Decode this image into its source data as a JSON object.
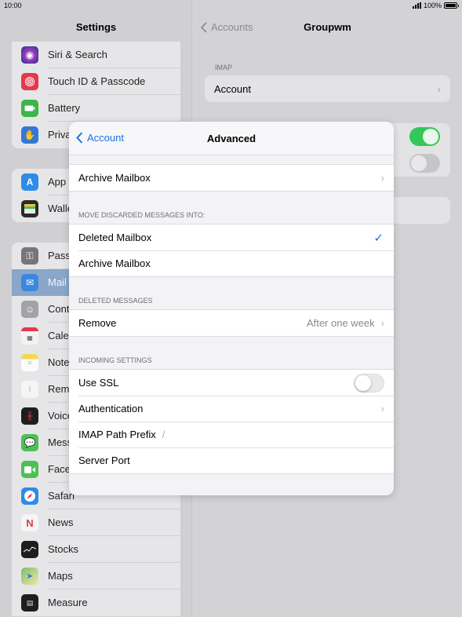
{
  "status": {
    "time": "10:00",
    "battery": "100%"
  },
  "settings": {
    "title": "Settings",
    "group1": [
      {
        "label": "Siri & Search",
        "icon": "siri-icon",
        "color": "#2c2c8e"
      },
      {
        "label": "Touch ID & Passcode",
        "icon": "fingerprint-icon",
        "color": "#e23a4c"
      },
      {
        "label": "Battery",
        "icon": "battery-icon",
        "color": "#3cb54a"
      },
      {
        "label": "Priva",
        "icon": "hand-icon",
        "color": "#3478d4"
      }
    ],
    "group2": [
      {
        "label": "App",
        "icon": "app-store-icon",
        "color": "#2f8be8"
      },
      {
        "label": "Walle",
        "icon": "wallet-icon",
        "color": "#2a2a2a"
      }
    ],
    "group3": [
      {
        "label": "Pass",
        "icon": "key-icon",
        "color": "#767679"
      },
      {
        "label": "Mail",
        "icon": "mail-icon",
        "color": "#3d86e0"
      },
      {
        "label": "Cont",
        "icon": "contacts-icon",
        "color": "#a3a3a6"
      },
      {
        "label": "Cale",
        "icon": "calendar-icon",
        "color": "#f3f3f3"
      },
      {
        "label": "Note",
        "icon": "notes-icon",
        "color": "#f5d84b"
      },
      {
        "label": "Rem",
        "icon": "reminders-icon",
        "color": "#f5f5f5"
      },
      {
        "label": "Voice",
        "icon": "voice-memos-icon",
        "color": "#1e1e1e"
      },
      {
        "label": "Mess",
        "icon": "messages-icon",
        "color": "#4cc055"
      },
      {
        "label": "Face",
        "icon": "facetime-icon",
        "color": "#4cc055"
      },
      {
        "label": "Safari",
        "icon": "safari-icon",
        "color": "#2f8be8"
      },
      {
        "label": "News",
        "icon": "news-icon",
        "color": "#f5f5f5"
      },
      {
        "label": "Stocks",
        "icon": "stocks-icon",
        "color": "#1e1e1e"
      },
      {
        "label": "Maps",
        "icon": "maps-icon",
        "color": "#7bbf6a"
      },
      {
        "label": "Measure",
        "icon": "measure-icon",
        "color": "#1e1e1e"
      }
    ]
  },
  "account": {
    "back_label": "Accounts",
    "title": "Groupwm",
    "imap_caption": "IMAP",
    "account_label": "Account"
  },
  "modal": {
    "back_label": "Account",
    "title": "Advanced",
    "archive_row": "Archive Mailbox",
    "discarded_caption": "MOVE DISCARDED MESSAGES INTO:",
    "discarded_options": [
      "Deleted Mailbox",
      "Archive Mailbox"
    ],
    "deleted_caption": "DELETED MESSAGES",
    "remove_label": "Remove",
    "remove_value": "After one week",
    "incoming_caption": "INCOMING SETTINGS",
    "use_ssl": "Use SSL",
    "authentication": "Authentication",
    "imap_prefix": "IMAP Path Prefix",
    "imap_prefix_value": "/",
    "server_port": "Server Port"
  },
  "colors": {
    "accent": "#1a73e8",
    "toggle_on": "#34c759"
  }
}
